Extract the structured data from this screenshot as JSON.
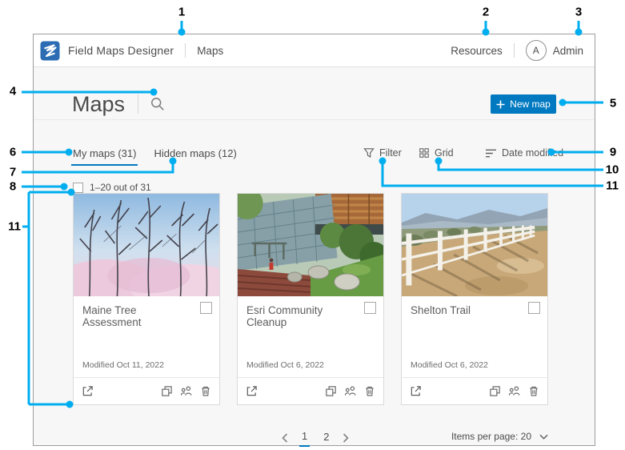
{
  "callouts": {
    "c1": "1",
    "c2": "2",
    "c3": "3",
    "c4": "4",
    "c5": "5",
    "c6": "6",
    "c7": "7",
    "c8": "8",
    "c9": "9",
    "c10": "10",
    "c11_left": "11",
    "c11_right": "11"
  },
  "header": {
    "app_title": "Field Maps Designer",
    "nav_current": "Maps",
    "resources_label": "Resources",
    "avatar_initial": "A",
    "user_label": "Admin"
  },
  "toolbar": {
    "page_title": "Maps",
    "new_map_label": "New map"
  },
  "tabs": {
    "my_maps": "My maps (31)",
    "hidden_maps": "Hidden maps (12)"
  },
  "list_controls": {
    "filter_label": "Filter",
    "view_label": "Grid",
    "sort_label": "Date modified"
  },
  "selection": {
    "range_label": "1–20 out of 31",
    "checked": false
  },
  "cards": [
    {
      "title": "Maine Tree Assessment",
      "modified_label": "Modified Oct 11, 2022",
      "selected": false,
      "thumbnail": "bare-trees-pink-blossoms"
    },
    {
      "title": "Esri Community Cleanup",
      "modified_label": "Modified Oct 6, 2022",
      "selected": false,
      "thumbnail": "campus-building-garden"
    },
    {
      "title": "Shelton Trail",
      "modified_label": "Modified Oct 6, 2022",
      "selected": false,
      "thumbnail": "white-fence-dirt-trail"
    }
  ],
  "pagination": {
    "pages": [
      "1",
      "2"
    ],
    "current_page": "1",
    "items_per_page_label": "Items per page: 20"
  },
  "icons": {
    "logo": "field-maps-logo",
    "search": "magnifying-glass",
    "plus": "plus",
    "filter": "funnel",
    "grid": "grid-squares",
    "sort": "descending-lines",
    "open": "open-in-new",
    "duplicate": "overlapping-squares",
    "share": "group-people",
    "delete": "trash-can",
    "prev": "chevron-left",
    "next": "chevron-right",
    "dropdown": "chevron-down"
  },
  "colors": {
    "accent_blue": "#0079c1",
    "callout_cyan": "#00aeef",
    "header_text": "#4c4c4c",
    "secondary_text": "#6e6e6e"
  }
}
